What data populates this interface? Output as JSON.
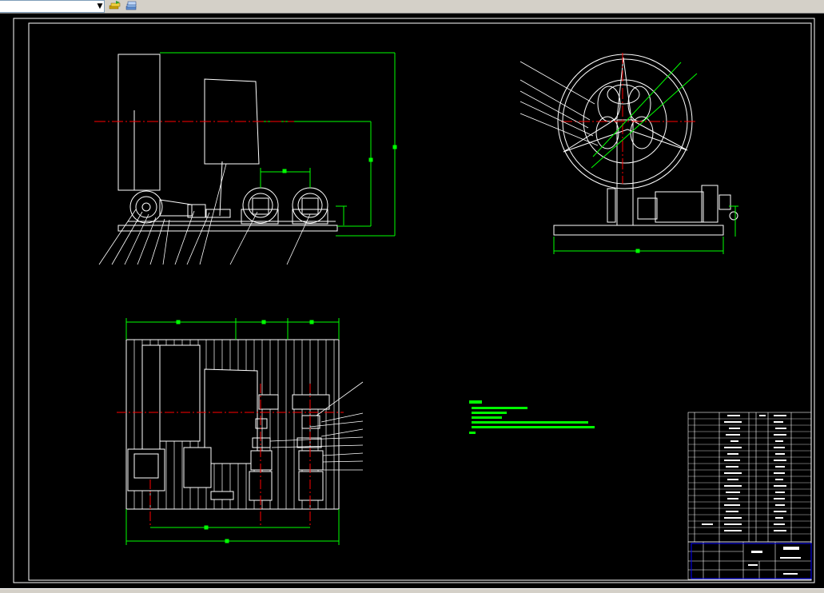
{
  "toolbar": {
    "layer_dropdown": {
      "value": ""
    },
    "icons": [
      "chevron-down-icon",
      "layer-states-icon",
      "layer-properties-icon"
    ]
  },
  "drawing": {
    "views": [
      "front-elevation-view",
      "side-elevation-view",
      "plan-view"
    ],
    "annotation_color": "#00ff00",
    "centerline_color": "#ff0000",
    "geometry_color": "#ffffff",
    "border_color": "#ffffff",
    "title_block_color": "#0000ff"
  },
  "colors": {
    "toolbar_bg": "#d4d0c8",
    "canvas_bg": "#000000"
  }
}
